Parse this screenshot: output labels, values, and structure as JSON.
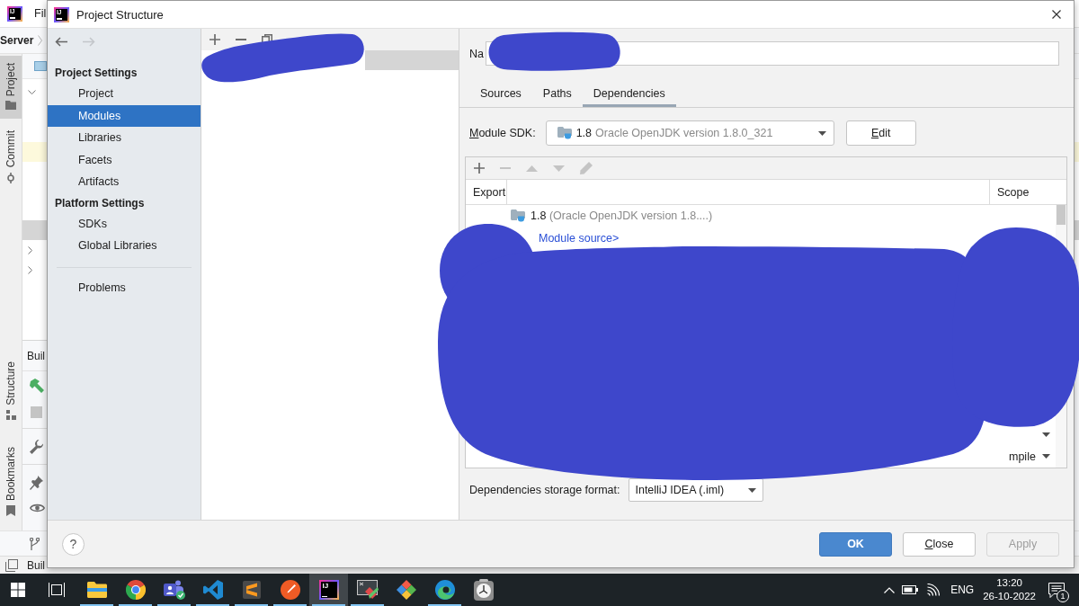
{
  "ide": {
    "logo": "IJ",
    "menu": "Fil",
    "breadcrumb": "Server",
    "stripe_top": [
      {
        "kind": "project",
        "label": "Project",
        "selected": true
      },
      {
        "kind": "commit",
        "label": "Commit",
        "selected": false
      }
    ],
    "stripe_bottom": [
      {
        "kind": "structure",
        "label": "Structure",
        "selected": false
      },
      {
        "kind": "bookmarks",
        "label": "Bookmarks",
        "selected": false
      }
    ],
    "build_tab": "Buil",
    "status": "Buil"
  },
  "dialog": {
    "logo": "IJ",
    "title": "Project Structure",
    "nav": [
      {
        "kind": "back",
        "disabled": false
      },
      {
        "kind": "forward",
        "disabled": true
      }
    ],
    "sidebar": [
      {
        "heading": "Project Settings",
        "items": [
          {
            "label": "Project",
            "selected": false
          },
          {
            "label": "Modules",
            "selected": true
          },
          {
            "label": "Libraries",
            "selected": false
          },
          {
            "label": "Facets",
            "selected": false
          },
          {
            "label": "Artifacts",
            "selected": false
          }
        ]
      },
      {
        "heading": "Platform Settings",
        "items": [
          {
            "label": "SDKs",
            "selected": false
          },
          {
            "label": "Global Libraries",
            "selected": false
          }
        ]
      },
      {
        "items": [
          {
            "label": "Problems",
            "selected": false
          }
        ]
      }
    ],
    "module_toolbar": [
      {
        "kind": "add"
      },
      {
        "kind": "remove"
      },
      {
        "kind": "copy"
      }
    ],
    "modules": [
      {
        "selected": true
      }
    ],
    "name_label": "Na",
    "tabs": [
      {
        "label": "Sources",
        "selected": false
      },
      {
        "label": "Paths",
        "selected": false
      },
      {
        "label": "Dependencies",
        "selected": true
      }
    ],
    "sdk_label": {
      "text": "Module SDK:",
      "mnemonic_underlined": true
    },
    "sdk": {
      "version": "1.8",
      "description": "Oracle OpenJDK version 1.8.0_321"
    },
    "edit_button": {
      "label": "Edit",
      "mnemonic_underlined": true
    },
    "dependencies": {
      "toolbar": [
        {
          "kind": "add",
          "disabled": false
        },
        {
          "kind": "remove",
          "disabled": true
        },
        {
          "kind": "up",
          "disabled": true
        },
        {
          "kind": "down",
          "disabled": true
        },
        {
          "kind": "edit",
          "disabled": true
        }
      ],
      "columns": [
        "Export",
        "Scope"
      ],
      "rows": [
        {
          "kind": "sdk",
          "name": "1.8",
          "detail": "(Oracle OpenJDK version 1.8....)"
        },
        {
          "kind": "source",
          "name": "Module source>"
        },
        {
          "kind": "covered"
        },
        {
          "kind": "covered",
          "scope": "mpile"
        }
      ]
    },
    "storage": {
      "label": "Dependencies storage format:",
      "value": "IntelliJ IDEA (.iml)"
    },
    "help": "?",
    "buttons": [
      {
        "label": "OK",
        "kind": "default",
        "disabled": false,
        "mnemonic_underlined": false
      },
      {
        "label": "Close",
        "kind": "normal",
        "disabled": false,
        "mnemonic_underlined": true
      },
      {
        "label": "Apply",
        "kind": "normal",
        "disabled": true,
        "mnemonic_underlined": false
      }
    ]
  },
  "taskbar": {
    "apps": [
      {
        "kind": "start",
        "running": false,
        "selected": false
      },
      {
        "kind": "task_view",
        "running": false,
        "selected": false
      },
      {
        "kind": "explorer",
        "running": true,
        "selected": false
      },
      {
        "kind": "chrome",
        "running": true,
        "selected": false
      },
      {
        "kind": "teams",
        "running": true,
        "selected": false
      },
      {
        "kind": "vscode",
        "running": true,
        "selected": false
      },
      {
        "kind": "sublime",
        "running": true,
        "selected": false
      },
      {
        "kind": "postman",
        "running": true,
        "selected": false
      },
      {
        "kind": "intellij",
        "logo": "IJ",
        "running": true,
        "selected": true
      },
      {
        "kind": "screen",
        "running": true,
        "selected": false
      },
      {
        "kind": "git",
        "running": false,
        "selected": false
      },
      {
        "kind": "edge",
        "running": true,
        "selected": false
      },
      {
        "kind": "clock",
        "running": false,
        "selected": false
      }
    ],
    "tray": {
      "language": "ENG",
      "time": "13:20",
      "date": "26-10-2022",
      "notifications": "1"
    }
  }
}
